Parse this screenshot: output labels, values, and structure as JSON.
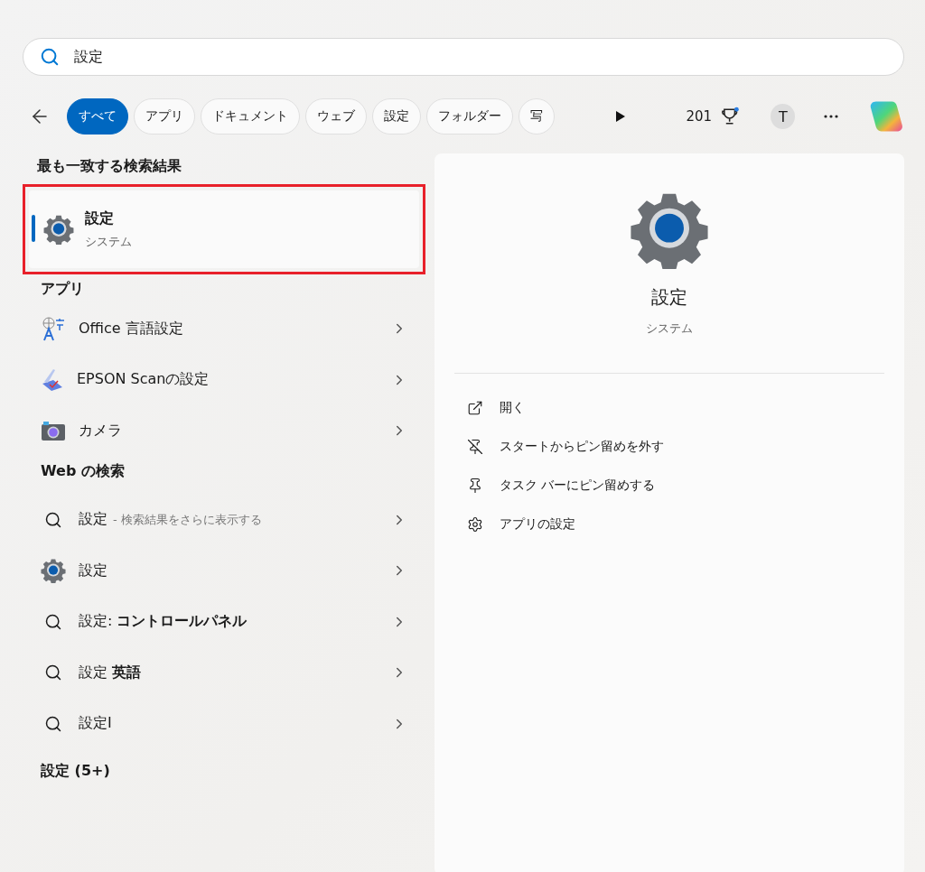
{
  "search": {
    "value": "設定"
  },
  "filters": [
    {
      "label": "すべて",
      "selected": true
    },
    {
      "label": "アプリ",
      "selected": false
    },
    {
      "label": "ドキュメント",
      "selected": false
    },
    {
      "label": "ウェブ",
      "selected": false
    },
    {
      "label": "設定",
      "selected": false
    },
    {
      "label": "フォルダー",
      "selected": false
    },
    {
      "label": "写",
      "selected": false
    }
  ],
  "points": "201",
  "avatar": "T",
  "best_match": {
    "heading": "最も一致する検索結果",
    "title": "設定",
    "subtitle": "システム",
    "selected": true,
    "highlighted": true
  },
  "apps": {
    "heading": "アプリ",
    "items": [
      {
        "kind": "language",
        "label": "Office 言語設定"
      },
      {
        "kind": "scanner",
        "label": "EPSON Scanの設定"
      },
      {
        "kind": "camera",
        "label": "カメラ"
      }
    ]
  },
  "web": {
    "heading": "Web の検索",
    "items": [
      {
        "kind": "search",
        "label": "設定",
        "hint": "- 検索結果をさらに表示する"
      },
      {
        "kind": "gear",
        "label": "設定"
      },
      {
        "kind": "search",
        "label": "設定: **コントロールパネル**"
      },
      {
        "kind": "search",
        "label": "設定 **英語**"
      },
      {
        "kind": "search",
        "label": "設定I"
      }
    ]
  },
  "more_heading": "設定 (5+)",
  "detail": {
    "title": "設定",
    "subtitle": "システム",
    "actions": [
      {
        "kind": "open",
        "label": "開く"
      },
      {
        "kind": "unpin",
        "label": "スタートからピン留めを外す"
      },
      {
        "kind": "pin",
        "label": "タスク バーにピン留めする"
      },
      {
        "kind": "settings",
        "label": "アプリの設定"
      }
    ]
  }
}
